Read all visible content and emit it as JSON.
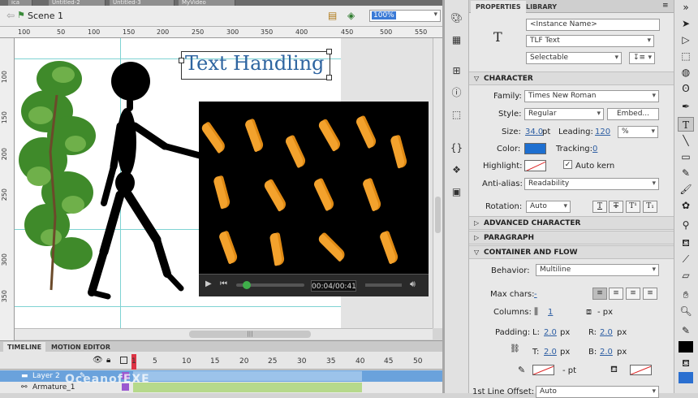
{
  "doc_tabs": [
    "ica",
    "Untitled-2",
    "Untitled-3",
    "MyVideo"
  ],
  "scene": {
    "label": "Scene 1",
    "zoom": "100%"
  },
  "ruler_h": [
    "100",
    "50",
    "100",
    "150",
    "200",
    "250",
    "300",
    "350",
    "400",
    "450",
    "500",
    "550"
  ],
  "ruler_v": [
    "100",
    "150",
    "200",
    "250",
    "300",
    "350"
  ],
  "stage": {
    "text_content": "Text Handling"
  },
  "video": {
    "time": "00:04/00:41"
  },
  "timeline": {
    "tabs": [
      "TIMELINE",
      "MOTION EDITOR"
    ],
    "frame_numbers": [
      "1",
      "5",
      "10",
      "15",
      "20",
      "25",
      "30",
      "35",
      "40",
      "45",
      "50"
    ],
    "layers": [
      "Layer 2",
      "Armature_1"
    ]
  },
  "watermark": "OceanofEXE",
  "properties": {
    "tabs": [
      "PROPERTIES",
      "LIBRARY"
    ],
    "instance_name_placeholder": "<Instance Name>",
    "text_engine": "TLF Text",
    "text_type": "Selectable",
    "sections": {
      "character": "CHARACTER",
      "advanced": "ADVANCED CHARACTER",
      "paragraph": "PARAGRAPH",
      "container": "CONTAINER AND FLOW"
    },
    "family_label": "Family:",
    "family": "Times New Roman",
    "style_label": "Style:",
    "style": "Regular",
    "embed_label": "Embed...",
    "size_label": "Size:",
    "size": "34.0",
    "size_unit": "pt",
    "leading_label": "Leading:",
    "leading": "120",
    "leading_unit": "%",
    "color_label": "Color:",
    "color": "#1e6fd0",
    "tracking_label": "Tracking:",
    "tracking": "0",
    "highlight_label": "Highlight:",
    "auto_kern_label": "Auto kern",
    "antialias_label": "Anti-alias:",
    "antialias": "Readability",
    "rotation_label": "Rotation:",
    "rotation": "Auto",
    "behavior_label": "Behavior:",
    "behavior": "Multiline",
    "max_chars_label": "Max chars:",
    "max_chars": "-",
    "columns_label": "Columns:",
    "columns": "1",
    "columns_px": "- px",
    "padding_label": "Padding:",
    "padding_l_label": "L:",
    "padding_l": "2.0",
    "padding_r_label": "R:",
    "padding_r": "2.0",
    "padding_t_label": "T:",
    "padding_t": "2.0",
    "padding_b_label": "B:",
    "padding_b": "2.0",
    "px": "px",
    "stroke_pt": "- pt",
    "first_line_offset_label": "1st Line Offset:",
    "first_line_offset": "Auto"
  }
}
